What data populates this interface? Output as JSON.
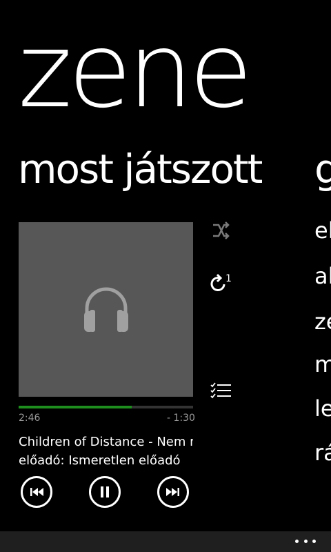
{
  "app": {
    "title": "zene"
  },
  "sections": {
    "current": "most játszott",
    "next_peek": "g"
  },
  "player": {
    "art_icon": "headphones-icon",
    "progress": 0.65,
    "elapsed": "2:46",
    "remaining": "- 1:30",
    "track_line": "Children of Distance - Nem m",
    "artist_line": "előadó: Ismeretlen előadó",
    "controls": [
      "previous-icon",
      "pause-icon",
      "next-icon"
    ],
    "side_icons": [
      "shuffle-icon",
      "repeat-one-icon",
      "playlist-icon"
    ],
    "repeat_badge": "1",
    "accent_color": "#1e8e1e"
  },
  "menu_peek": [
    "el",
    "al",
    "ze",
    "m",
    "le",
    "rá"
  ],
  "app_bar": {
    "more_icon": "more-dots-icon"
  }
}
